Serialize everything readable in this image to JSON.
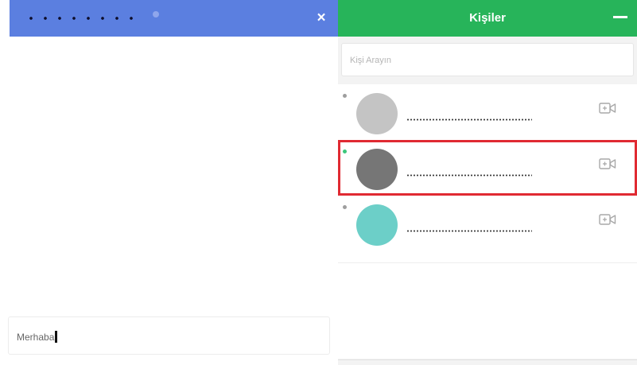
{
  "chat": {
    "close_symbol": "×",
    "input_value": "Merhaba"
  },
  "contacts": {
    "title": "Kişiler",
    "search_placeholder": "Kişi Arayın",
    "items": [
      {
        "status_color": "#9e9e9e",
        "avatar_color": "#c4c4c4",
        "icon": "video-camera-icon",
        "selected": false
      },
      {
        "status_color": "#3cc77b",
        "avatar_color": "#767676",
        "icon": "video-camera-icon",
        "selected": true
      },
      {
        "status_color": "#9e9e9e",
        "avatar_color": "#6ccfc8",
        "icon": "video-camera-icon",
        "selected": false
      }
    ]
  },
  "colors": {
    "chat_header": "#5b7fe0",
    "contacts_header": "#27b45a",
    "selection_outline": "#e02a32"
  }
}
